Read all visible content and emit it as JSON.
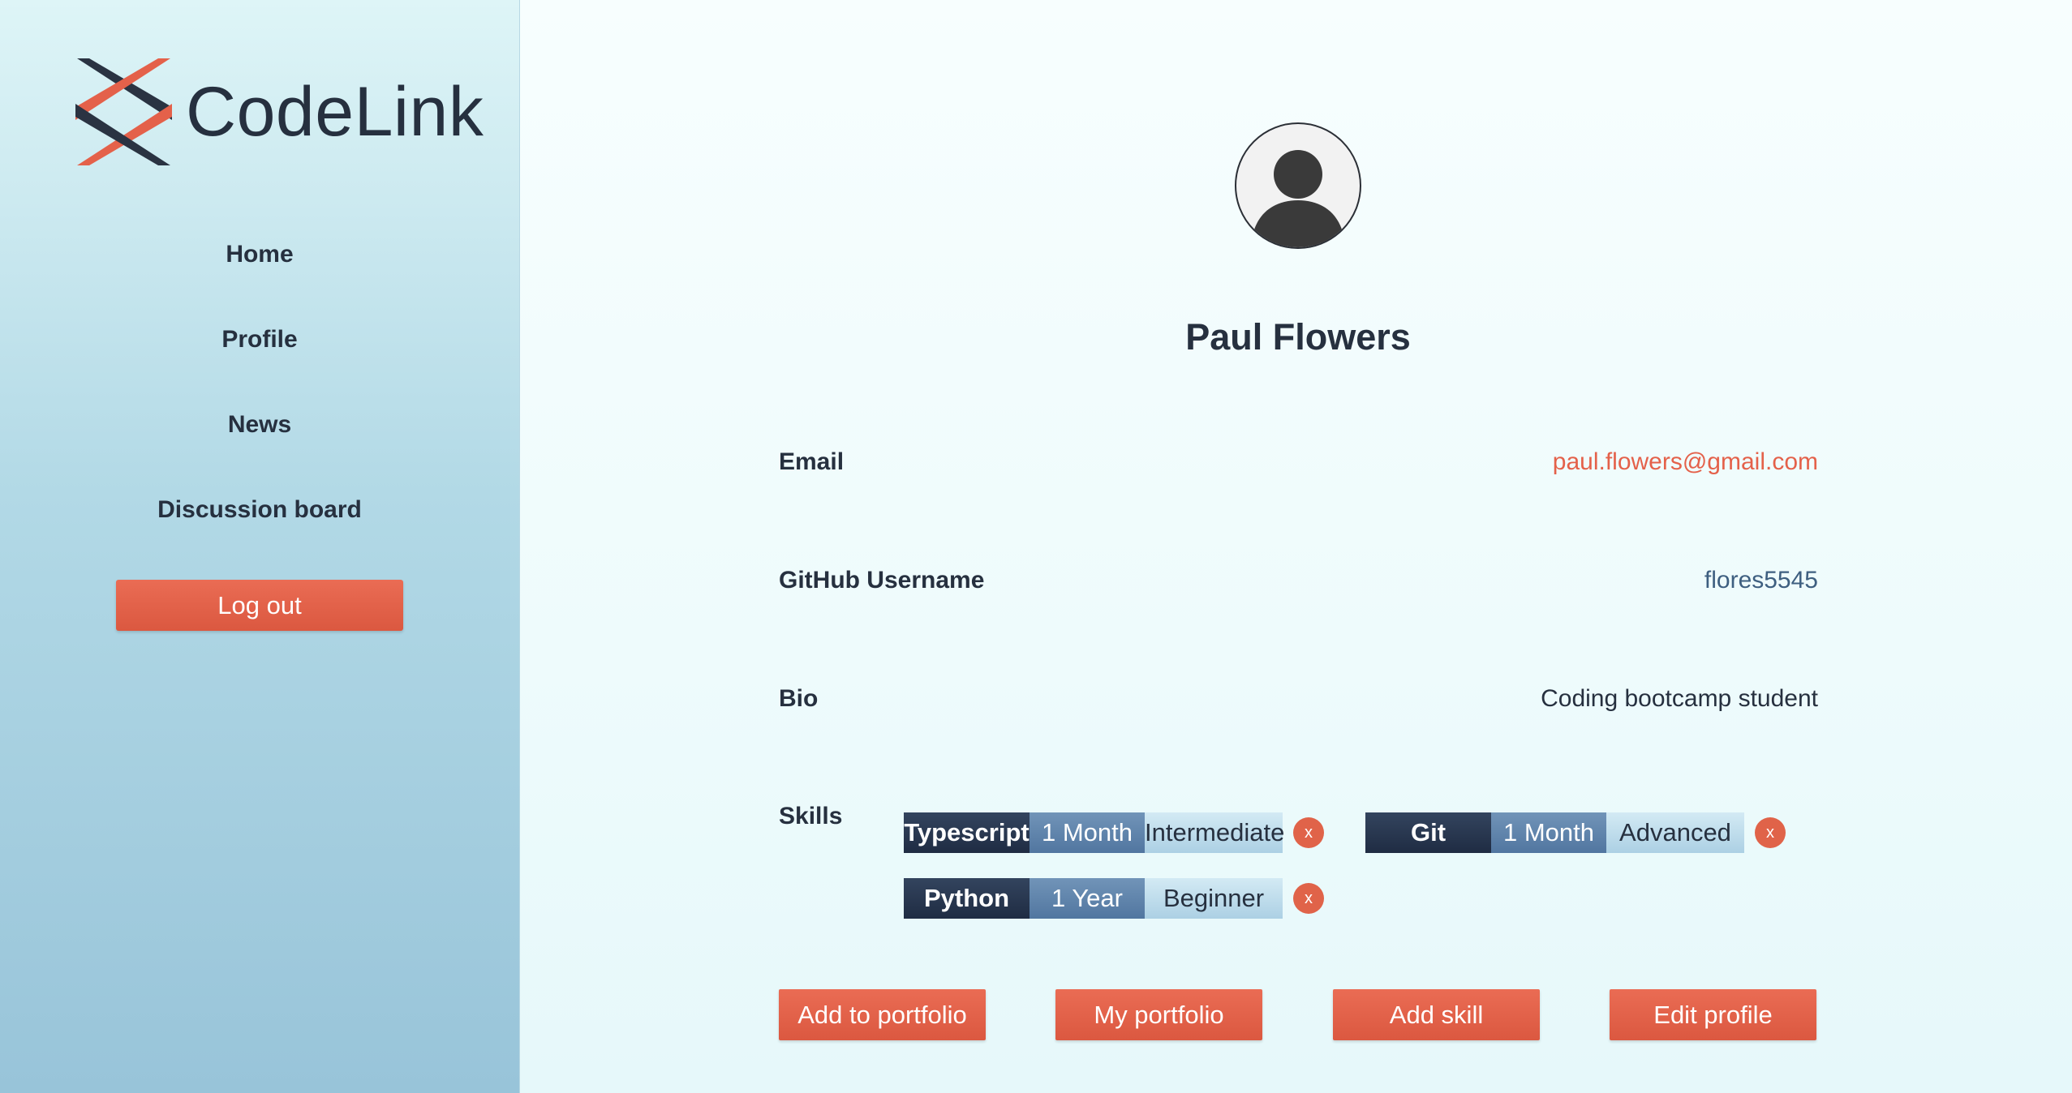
{
  "brand": {
    "name": "CodeLink",
    "logo_icon": "codelink-logo-icon"
  },
  "nav": {
    "items": [
      {
        "label": "Home"
      },
      {
        "label": "Profile"
      },
      {
        "label": "News"
      },
      {
        "label": "Discussion board"
      }
    ],
    "logout_label": "Log out"
  },
  "profile": {
    "avatar_icon": "user-avatar-icon",
    "name": "Paul Flowers",
    "email_label": "Email",
    "email": "paul.flowers@gmail.com",
    "github_label": "GitHub Username",
    "github": "flores5545",
    "bio_label": "Bio",
    "bio": "Coding bootcamp student",
    "skills_label": "Skills",
    "skills": [
      {
        "name": "Typescript",
        "duration": "1 Month",
        "level": "Intermediate",
        "remove": "x"
      },
      {
        "name": "Git",
        "duration": "1 Month",
        "level": "Advanced",
        "remove": "x"
      },
      {
        "name": "Python",
        "duration": "1 Year",
        "level": "Beginner",
        "remove": "x"
      }
    ]
  },
  "actions": {
    "add_to_portfolio": "Add to portfolio",
    "my_portfolio": "My portfolio",
    "add_skill": "Add skill",
    "edit_profile": "Edit profile"
  },
  "colors": {
    "accent": "#E4614A",
    "navy": "#26303F",
    "email_link": "#E4614A",
    "github_text": "#3E5F80"
  }
}
